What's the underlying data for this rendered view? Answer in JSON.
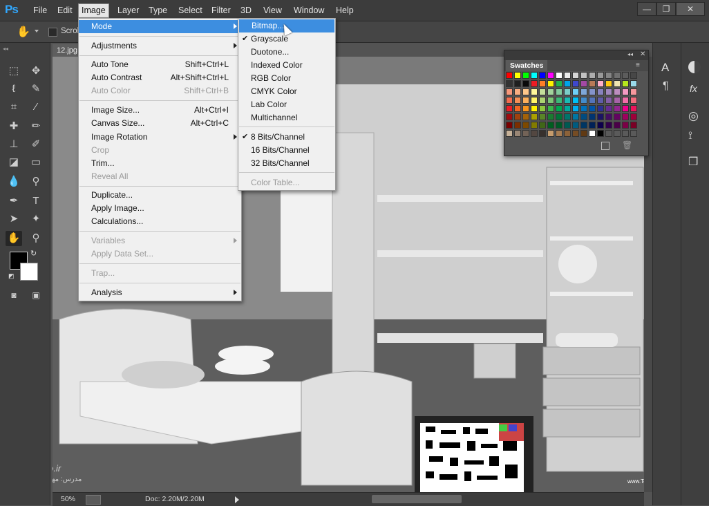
{
  "app": {
    "logo": "Ps"
  },
  "menubar": {
    "items": [
      "File",
      "Edit",
      "Image",
      "Layer",
      "Type",
      "Select",
      "Filter",
      "3D",
      "View",
      "Window",
      "Help"
    ],
    "active": "Image"
  },
  "window_controls": {
    "minimize": "—",
    "restore": "❐",
    "close": "✕"
  },
  "options_bar": {
    "scroll_all_windows_label": "Scrol"
  },
  "document": {
    "tab_label": "12.jpg"
  },
  "status": {
    "zoom": "50%",
    "doc_info": "Doc: 2.20M/2.20M"
  },
  "swatches_panel": {
    "title": "Swatches"
  },
  "image_menu": {
    "mode": "Mode",
    "adjustments": "Adjustments",
    "auto_tone": "Auto Tone",
    "auto_tone_sc": "Shift+Ctrl+L",
    "auto_contrast": "Auto Contrast",
    "auto_contrast_sc": "Alt+Shift+Ctrl+L",
    "auto_color": "Auto Color",
    "auto_color_sc": "Shift+Ctrl+B",
    "image_size": "Image Size...",
    "image_size_sc": "Alt+Ctrl+I",
    "canvas_size": "Canvas Size...",
    "canvas_size_sc": "Alt+Ctrl+C",
    "image_rotation": "Image Rotation",
    "crop": "Crop",
    "trim": "Trim...",
    "reveal_all": "Reveal All",
    "duplicate": "Duplicate...",
    "apply_image": "Apply Image...",
    "calculations": "Calculations...",
    "variables": "Variables",
    "apply_data_set": "Apply Data Set...",
    "trap": "Trap...",
    "analysis": "Analysis"
  },
  "mode_menu": {
    "bitmap": "Bitmap...",
    "grayscale": "Grayscale",
    "duotone": "Duotone...",
    "indexed": "Indexed Color",
    "rgb": "RGB Color",
    "cmyk": "CMYK Color",
    "lab": "Lab Color",
    "multichannel": "Multichannel",
    "bits8": "8 Bits/Channel",
    "bits16": "16 Bits/Channel",
    "bits32": "32 Bits/Channel",
    "color_table": "Color Table..."
  },
  "watermarks": {
    "left": "safaStudio.ir",
    "left_sub": "مدرس: مهندس فدائی",
    "right": "www.TeacherMan.ir"
  },
  "colors": {
    "accent": "#3d8ee0",
    "foreground": "#000000",
    "background": "#ffffff"
  }
}
